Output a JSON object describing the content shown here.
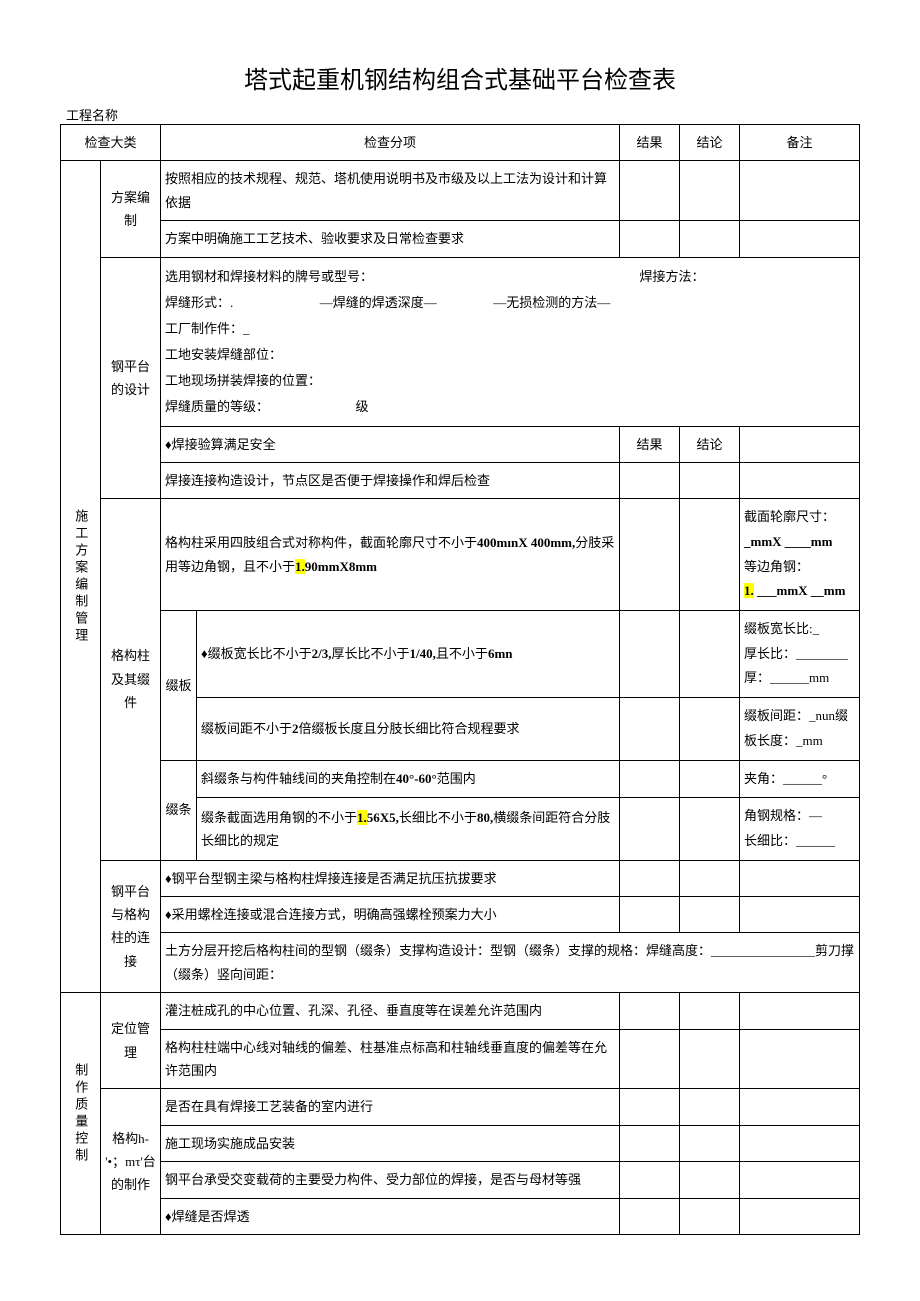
{
  "title": "塔式起重机钢结构组合式基础平台检查表",
  "project_name_label": "工程名称",
  "header": {
    "major": "检查大类",
    "sub_item": "检查分项",
    "result": "结果",
    "conclusion": "结论",
    "note": "备注"
  },
  "sec1": {
    "major": "施工方案编制管理",
    "g1": {
      "label": "方案编制",
      "r1": "按照相应的技术规程、规范、塔机使用说明书及市级及以上工法为设计和计算依据",
      "r2": "方案中明确施工工艺技术、验收要求及日常检查要求"
    },
    "g2": {
      "label": "钢平台的设计",
      "block": {
        "l1a": "选用钢材和焊接材料的牌号或型号：",
        "l1b": "焊接方法：",
        "l2a": "焊缝形式：.",
        "l2b": "—焊缝的焊透深度—",
        "l2c": "—无损检测的方法—",
        "l3": "工厂制作件：_",
        "l4": "工地安装焊缝部位：",
        "l5": "工地现场拼装焊接的位置：",
        "l6a": "焊缝质量的等级：",
        "l6b": "级"
      },
      "r2": "♦焊接验算满足安全",
      "r2_res": "结果",
      "r2_concl": "结论",
      "r3": "焊接连接构造设计，节点区是否便于焊接操作和焊后检查"
    },
    "g3": {
      "label": "格构柱及其缀件",
      "r1a": "格构柱采用四肢组合式对称构件，截面轮廓尺寸不小于",
      "r1b": "400mınX 400mm,",
      "r1c": "分肢采用等边角钢，且不小于",
      "r1d": "1.",
      "r1e": "90mmX8mm",
      "r1_note_l1": "截面轮廓尺寸：",
      "r1_note_l2": "_mmX ____mm",
      "r1_note_l3": "等边角钢：",
      "r1_note_l4a": "1.",
      "r1_note_l4b": " ___mmX __mm",
      "sub_banban": "缀板",
      "r2a": "♦缀板宽长比不小于",
      "r2b": "2/3,",
      "r2c": "厚长比不小于",
      "r2d": "1/40,",
      "r2e": "且不小于",
      "r2f": "6mn",
      "r2_note": "缀板宽长比:_\n厚长比：________\n厚：______mm",
      "r3a": "缀板间距不小于",
      "r3b": "2",
      "r3c": "倍缀板长度且分肢长细比符合规程要求",
      "r3_note": "缀板间距：_nun缀板长度：_mm",
      "sub_tiao": "缀条",
      "r4a": "斜缀条与构件轴线间的夹角控制在",
      "r4b": "40°-60°",
      "r4c": "范围内",
      "r4_note": "夹角：______°",
      "r5a": "缀条截面选用角钢的不小于",
      "r5b": "1.",
      "r5c": "56X5,",
      "r5d": "长细比不小于",
      "r5e": "80,",
      "r5f": "横缀条间距符合分肢长细比的规定",
      "r5_note": "角钢规格：—\n长细比：______"
    },
    "g4": {
      "label": "钢平台与格构柱的连接",
      "r1": "♦钢平台型钢主梁与格构柱焊接连接是否满足抗压抗拔要求",
      "r2": "♦采用螺栓连接或混合连接方式，明确高强螺栓预案力大小",
      "r3": "土方分层开挖后格构柱间的型钢（缀条）支撑构造设计：型钢（缀条）支撑的规格：焊缝高度：________________剪刀撑（缀条）竖向间距："
    }
  },
  "sec2": {
    "major": "制作质量控制",
    "g1": {
      "label": "定位管理",
      "r1": "灌注桩成孔的中心位置、孔深、孔径、垂直度等在误差允许范围内",
      "r2": "格构柱柱端中心线对轴线的偏差、柱基准点标高和柱轴线垂直度的偏差等在允许范围内"
    },
    "g2": {
      "label": "格构h-'•；mτ'台的制作",
      "r1": "是否在具有焊接工艺装备的室内进行",
      "r2": "施工现场实施成品安装",
      "r3": "钢平台承受交变载荷的主要受力构件、受力部位的焊接，是否与母材等强",
      "r4": "♦焊缝是否焊透"
    }
  }
}
